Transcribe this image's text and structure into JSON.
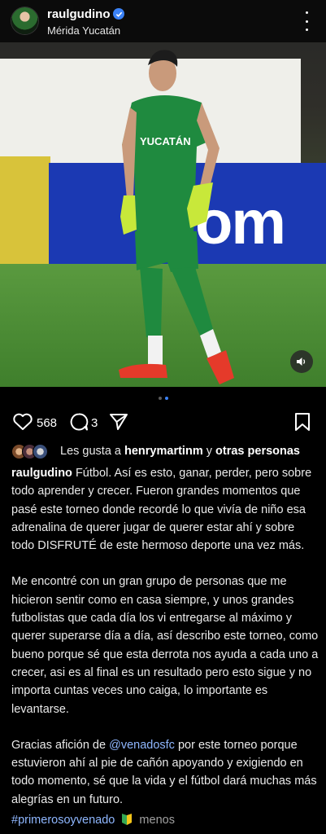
{
  "header": {
    "username": "raulgudino",
    "location": "Mérida Yucatán",
    "verified": true
  },
  "photo": {
    "jersey_text": "YUCATÁN",
    "board_text": "om",
    "sound_icon": "speaker-icon"
  },
  "carousel": {
    "count": 2,
    "active": 1
  },
  "actions": {
    "likes": "568",
    "comments": "3"
  },
  "likes_row": {
    "prefix": "Les gusta a",
    "user": "henrymartinm",
    "connector": "y",
    "others": "otras personas"
  },
  "caption": {
    "author": "raulgudino",
    "p1": "Fútbol. Así es esto, ganar, perder, pero sobre todo aprender y crecer. Fueron grandes momentos que pasé este torneo donde recordé lo que vivía de niño esa adrenalina de querer jugar de querer estar ahí y sobre todo DISFRUTÉ de este hermoso deporte una vez más.",
    "p2": "Me encontré con un gran grupo de personas que me hicieron sentir como en casa siempre, y unos grandes futbolistas que cada día los vi entregarse al máximo y querer superarse día a día, así describo este torneo, como bueno porque sé que esta derrota nos ayuda a cada uno a crecer, asi es al final es un resultado pero esto sigue y no importa cuntas veces uno caiga, lo importante es levantarse.",
    "p3_before": "Gracias afición de",
    "p3_mention": "@venadosfc",
    "p3_after": "por este torneo porque estuvieron ahí al pie de cañón apoyando y exigiendo en todo momento, sé que la vida y el fútbol dará muchas más alegrías en un futuro.",
    "hashtag": "#primerosoyvenado",
    "more": "menos"
  },
  "colors": {
    "accent_link": "#8fb7ff",
    "verified_blue": "#3b82f6",
    "background": "#000000"
  }
}
